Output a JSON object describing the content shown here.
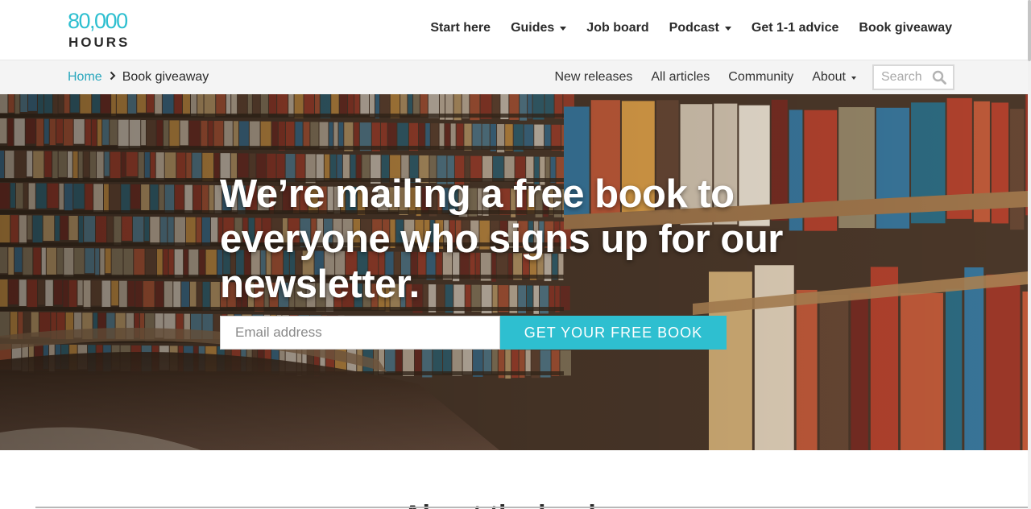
{
  "logo": {
    "number": "80,000",
    "word": "HOURS"
  },
  "main_nav": {
    "items": [
      {
        "label": "Start here",
        "dropdown": false
      },
      {
        "label": "Guides",
        "dropdown": true
      },
      {
        "label": "Job board",
        "dropdown": false
      },
      {
        "label": "Podcast",
        "dropdown": true
      },
      {
        "label": "Get 1-1 advice",
        "dropdown": false
      },
      {
        "label": "Book giveaway",
        "dropdown": false
      }
    ]
  },
  "breadcrumb": {
    "home": "Home",
    "current": "Book giveaway"
  },
  "sub_nav": {
    "items": [
      {
        "label": "New releases"
      },
      {
        "label": "All articles"
      },
      {
        "label": "Community"
      },
      {
        "label": "About"
      }
    ],
    "search_placeholder": "Search"
  },
  "hero": {
    "title": "We’re mailing a free book to everyone who signs up for our newsletter.",
    "email_placeholder": "Email address",
    "cta_label": "GET YOUR FREE BOOK"
  },
  "section": {
    "heading": "About the book"
  },
  "colors": {
    "accent": "#2ebfd0",
    "link": "#2aa7bd",
    "text": "#2b2b2b",
    "subheader_bg": "#f4f4f4"
  },
  "icons": {
    "search": "search-icon",
    "caret": "caret-down-icon",
    "breadcrumb_separator": "chevron-right-icon"
  }
}
